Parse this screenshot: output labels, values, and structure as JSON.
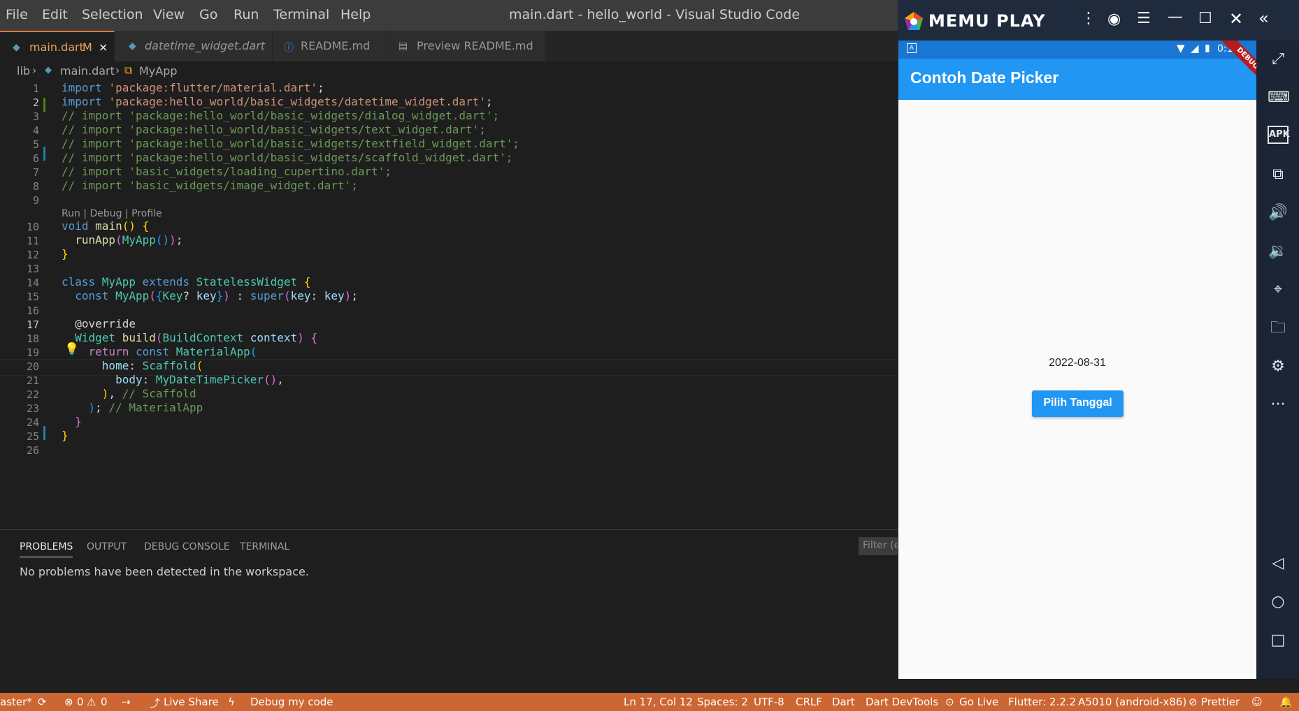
{
  "menu": [
    "File",
    "Edit",
    "Selection",
    "View",
    "Go",
    "Run",
    "Terminal",
    "Help"
  ],
  "window_title": "main.dart - hello_world - Visual Studio Code",
  "tabs": [
    {
      "label": "main.dart",
      "badge": "M",
      "close": "×",
      "active": true
    },
    {
      "label": "datetime_widget.dart"
    },
    {
      "label": "README.md"
    },
    {
      "label": "Preview README.md"
    }
  ],
  "breadcrumb": {
    "folder": "lib",
    "file": "main.dart",
    "symbol": "MyApp"
  },
  "codelens": "Run | Debug | Profile",
  "line_numbers": [
    "1",
    "2",
    "3",
    "4",
    "5",
    "6",
    "7",
    "8",
    "9",
    "10",
    "11",
    "12",
    "13",
    "14",
    "15",
    "16",
    "17",
    "18",
    "19",
    "20",
    "21",
    "22",
    "23",
    "24",
    "25",
    "26"
  ],
  "panel": {
    "tabs": [
      "PROBLEMS",
      "OUTPUT",
      "DEBUG CONSOLE",
      "TERMINAL"
    ],
    "filter_placeholder": "Filter (e",
    "message": "No problems have been detected in the workspace."
  },
  "statusbar": {
    "branch": "aster*",
    "errors": "0",
    "warnings": "0",
    "live_share": "Live Share",
    "debug": "Debug my code",
    "position": "Ln 17, Col 12",
    "spaces": "Spaces: 2",
    "encoding": "UTF-8",
    "eol": "CRLF",
    "language": "Dart",
    "devtools": "Dart DevTools",
    "go_live": "Go Live",
    "flutter": "Flutter: 2.2.2",
    "device": "A5010 (android-x86)",
    "prettier": "Prettier"
  },
  "emulator": {
    "brand": "MEMU PLAY",
    "phone_time": "0:19",
    "debug_banner": "DEBUG",
    "app_title": "Contoh Date Picker",
    "date_text": "2022-08-31",
    "button_label": "Pilih Tanggal",
    "colors": {
      "appbar": "#2196f3",
      "button": "#2196f3",
      "status": "#cc6633"
    }
  }
}
